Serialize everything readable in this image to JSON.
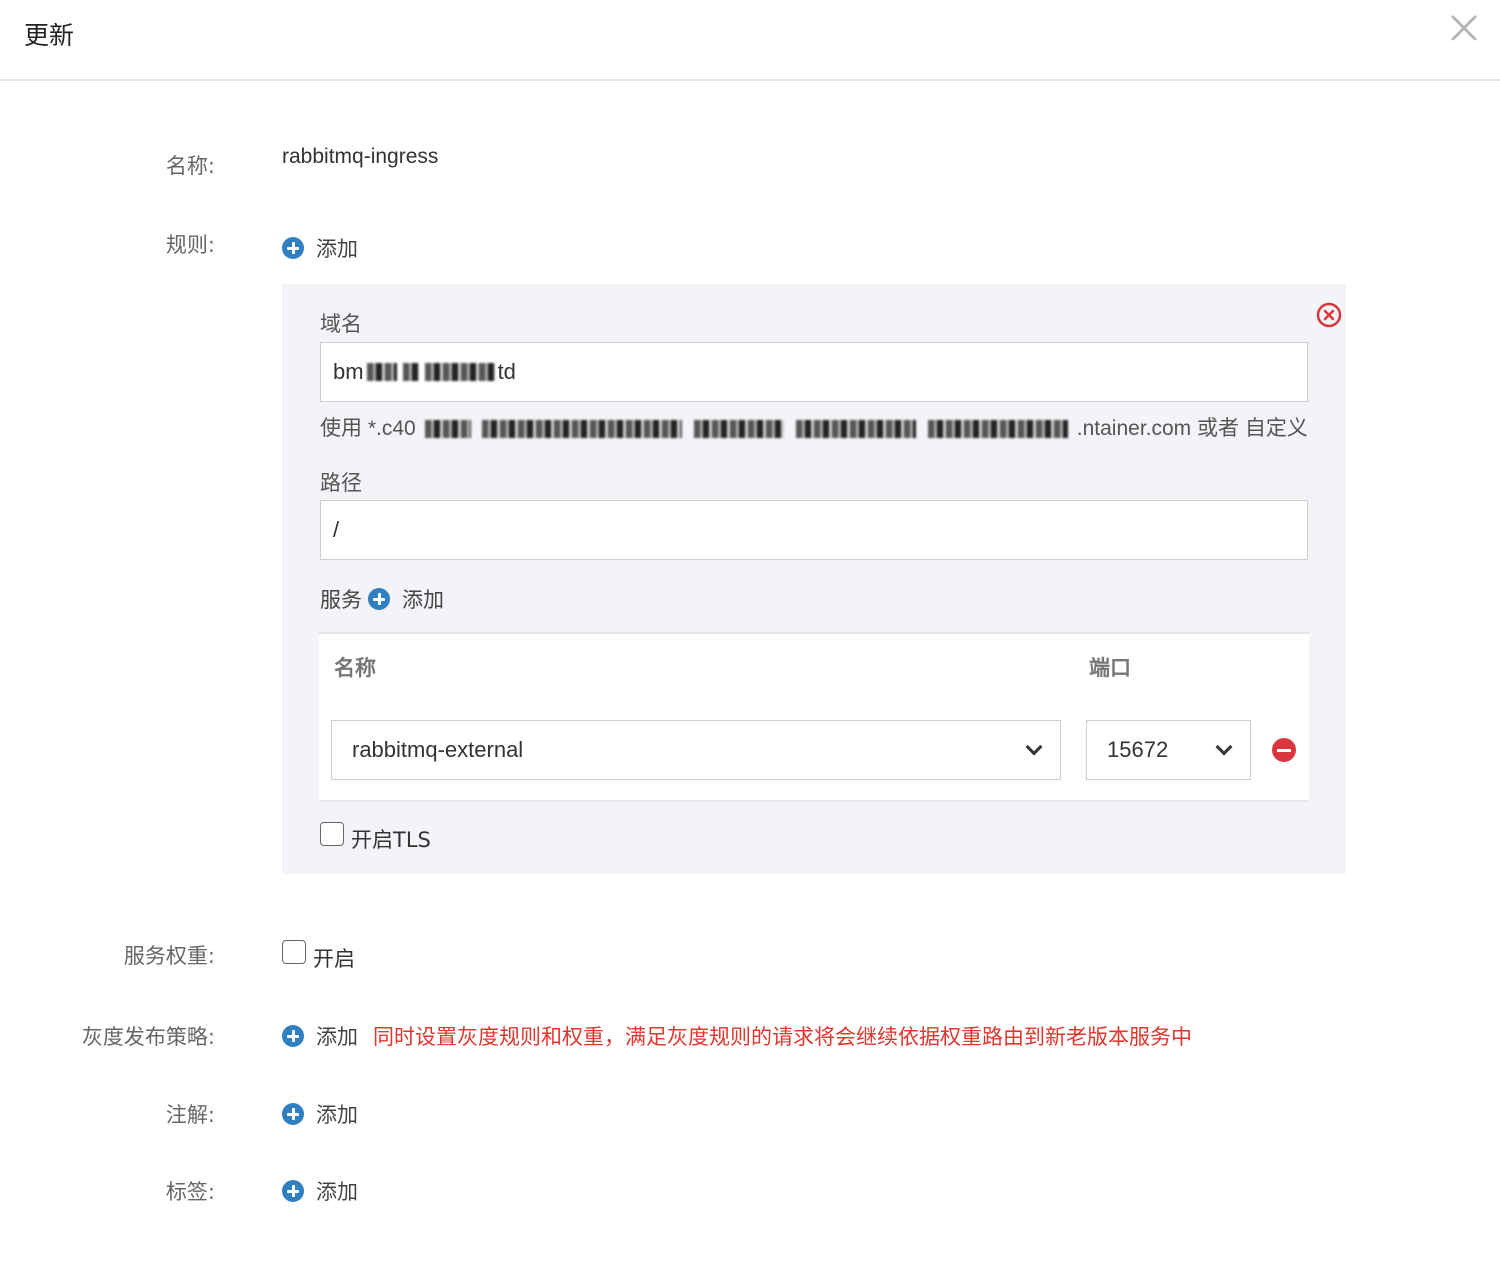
{
  "dialog": {
    "title": "更新",
    "close_icon": "close-icon"
  },
  "form": {
    "name_label": "名称:",
    "name_value": "rabbitmq-ingress",
    "rules_label": "规则:",
    "add_label": "添加",
    "service_weight_label": "服务权重:",
    "service_weight_option": "开启",
    "gray_label": "灰度发布策略:",
    "gray_warning": "同时设置灰度规则和权重，满足灰度规则的请求将会继续依据权重路由到新老版本服务中",
    "annotation_label": "注解:",
    "tag_label": "标签:"
  },
  "rule": {
    "domain_label": "域名",
    "domain_prefix": "bm",
    "domain_suffix": "td",
    "domain_hint_prefix": "使用 *.c40",
    "domain_hint_suffix": ".ntainer.com 或者 自定义",
    "path_label": "路径",
    "path_value": "/",
    "service_label": "服务",
    "service_add": "添加",
    "table": {
      "col_name": "名称",
      "col_port": "端口",
      "rows": [
        {
          "service": "rabbitmq-external",
          "port": "15672"
        }
      ]
    },
    "tls_label": "开启TLS"
  },
  "colors": {
    "accent": "#2f7fc1",
    "danger": "#d9363e",
    "warning_text": "#e0372e",
    "panel_bg": "#f2f4f8"
  }
}
